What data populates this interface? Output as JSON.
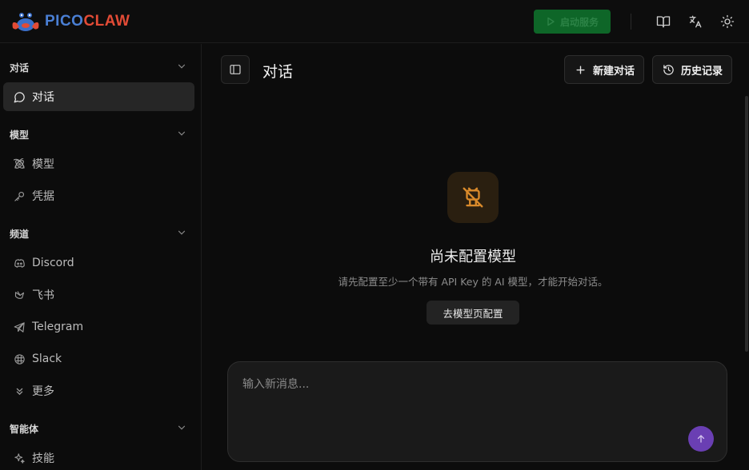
{
  "app": {
    "logo_pico": "PICO",
    "logo_claw": "CLAW",
    "start_service": "启动服务"
  },
  "top_icons": [
    "book-icon",
    "translate-icon",
    "sun-icon"
  ],
  "sidebar": {
    "sections": [
      {
        "title": "对话",
        "items": [
          {
            "label": "对话",
            "icon": "chat-icon",
            "active": true
          }
        ]
      },
      {
        "title": "模型",
        "items": [
          {
            "label": "模型",
            "icon": "model-icon"
          },
          {
            "label": "凭据",
            "icon": "key-icon"
          }
        ]
      },
      {
        "title": "频道",
        "items": [
          {
            "label": "Discord",
            "icon": "discord-icon"
          },
          {
            "label": "飞书",
            "icon": "feishu-icon"
          },
          {
            "label": "Telegram",
            "icon": "telegram-icon"
          },
          {
            "label": "Slack",
            "icon": "slack-icon"
          },
          {
            "label": "更多",
            "icon": "chevrons-down-icon"
          }
        ]
      },
      {
        "title": "智能体",
        "items": [
          {
            "label": "技能",
            "icon": "sparkles-icon"
          }
        ]
      }
    ]
  },
  "main": {
    "title": "对话",
    "new_chat": "新建对话",
    "history": "历史记录",
    "empty_title": "尚未配置模型",
    "empty_desc": "请先配置至少一个带有 API Key 的 AI 模型，才能开始对话。",
    "config_button": "去模型页配置",
    "composer_placeholder": "输入新消息..."
  },
  "colors": {
    "accent_green": "#0f6b2a",
    "accent_purple": "#6a3fb3",
    "warning_orange": "#d98a2b"
  }
}
